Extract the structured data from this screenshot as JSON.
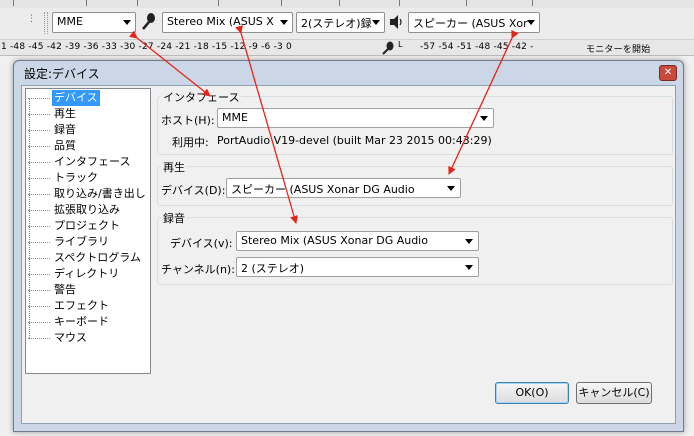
{
  "toolbar": {
    "host_combo": "MME",
    "recording_combo": "Stereo Mix (ASUS X",
    "channels_combo": "2(ステレオ)録",
    "playback_combo": "スピーカー (ASUS Xor",
    "icons": [
      "microphone-icon",
      "speaker-icon",
      "meter-icon"
    ]
  },
  "ruler": {
    "left_scale": "1  -48  -45  -42  -39  -36  -33  -30  -27  -24  -21  -18  -15  -12  -9  -6  -3  0",
    "right_scale": "-57  -54  -51  -48  -45  -42  -",
    "right_label": "モニターを開始"
  },
  "dialog": {
    "title": "設定:デバイス",
    "close_symbol": "✕",
    "tree": [
      {
        "label": "デバイス",
        "selected": true
      },
      {
        "label": "再生"
      },
      {
        "label": "録音"
      },
      {
        "label": "品質"
      },
      {
        "label": "インタフェース"
      },
      {
        "label": "トラック"
      },
      {
        "label": "取り込み/書き出し"
      },
      {
        "label": "拡張取り込み"
      },
      {
        "label": "プロジェクト"
      },
      {
        "label": "ライブラリ"
      },
      {
        "label": "スペクトログラム"
      },
      {
        "label": "ディレクトリ"
      },
      {
        "label": "警告"
      },
      {
        "label": "エフェクト"
      },
      {
        "label": "キーボード"
      },
      {
        "label": "マウス"
      }
    ],
    "interface": {
      "group_label": "インタフェース",
      "host_label": "ホスト(H):",
      "host_value": "MME",
      "using_label": "利用中:",
      "using_value": "PortAudio V19-devel (built Mar 23 2015 00:43:29)"
    },
    "playback": {
      "group_label": "再生",
      "device_label": "デバイス(D):",
      "device_value": "スピーカー (ASUS Xonar DG Audio"
    },
    "recording": {
      "group_label": "録音",
      "device_label": "デバイス(v):",
      "device_value": "Stereo Mix (ASUS Xonar DG Audio",
      "channels_label": "チャンネル(n):",
      "channels_value": "2 (ステレオ)"
    },
    "ok_button": "OK(O)",
    "cancel_button": "キャンセル(C)"
  },
  "colors": {
    "annotation_arrow": "#e8231a",
    "selection": "#3399ff"
  }
}
